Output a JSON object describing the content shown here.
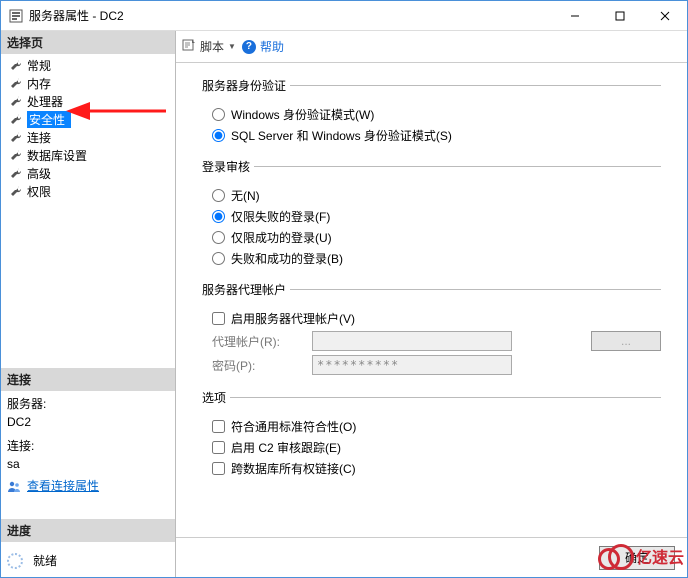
{
  "window": {
    "title": "服务器属性 - DC2"
  },
  "sidebar": {
    "select_page": "选择页",
    "items": [
      {
        "label": "常规"
      },
      {
        "label": "内存"
      },
      {
        "label": "处理器"
      },
      {
        "label": "安全性",
        "selected": true
      },
      {
        "label": "连接"
      },
      {
        "label": "数据库设置"
      },
      {
        "label": "高级"
      },
      {
        "label": "权限"
      }
    ],
    "connection_hdr": "连接",
    "conn": {
      "server_label": "服务器:",
      "server_value": "DC2",
      "conn_label": "连接:",
      "conn_value": "sa",
      "view_props": "查看连接属性"
    },
    "progress_hdr": "进度",
    "progress_status": "就绪"
  },
  "toolbar": {
    "script": "脚本",
    "help": "帮助"
  },
  "content": {
    "auth": {
      "legend": "服务器身份验证",
      "opt1": "Windows 身份验证模式(W)",
      "opt2": "SQL Server 和 Windows 身份验证模式(S)"
    },
    "audit": {
      "legend": "登录审核",
      "opt_none": "无(N)",
      "opt_failed": "仅限失败的登录(F)",
      "opt_success": "仅限成功的登录(U)",
      "opt_both": "失败和成功的登录(B)"
    },
    "proxy": {
      "legend": "服务器代理帐户",
      "enable": "启用服务器代理帐户(V)",
      "proxy_label": "代理帐户(R):",
      "password_label": "密码(P):",
      "password_value": "**********",
      "browse": "..."
    },
    "options": {
      "legend": "选项",
      "common_criteria": "符合通用标准符合性(O)",
      "c2_audit": "启用 C2 审核跟踪(E)",
      "cross_db": "跨数据库所有权链接(C)"
    }
  },
  "footer": {
    "ok": "确定"
  },
  "watermark": "亿速云"
}
